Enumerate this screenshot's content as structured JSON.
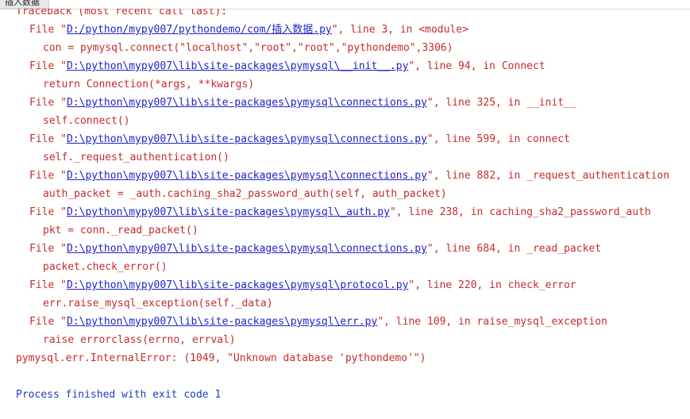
{
  "tab": {
    "title": "插入数据"
  },
  "console": {
    "header": "Traceback (most recent call last):",
    "frames": [
      {
        "prefix": "File \"",
        "path": "D:/python/mypy007/pythondemo/com/插入数据.py",
        "suffix": "\", line 3, in <module>",
        "code": "con = pymysql.connect(\"localhost\",\"root\",\"root\",\"pythondemo\",3306)"
      },
      {
        "prefix": "File \"",
        "path": "D:\\python\\mypy007\\lib\\site-packages\\pymysql\\__init__.py",
        "suffix": "\", line 94, in Connect",
        "code": "return Connection(*args, **kwargs)"
      },
      {
        "prefix": "File \"",
        "path": "D:\\python\\mypy007\\lib\\site-packages\\pymysql\\connections.py",
        "suffix": "\", line 325, in __init__",
        "code": "self.connect()"
      },
      {
        "prefix": "File \"",
        "path": "D:\\python\\mypy007\\lib\\site-packages\\pymysql\\connections.py",
        "suffix": "\", line 599, in connect",
        "code": "self._request_authentication()"
      },
      {
        "prefix": "File \"",
        "path": "D:\\python\\mypy007\\lib\\site-packages\\pymysql\\connections.py",
        "suffix": "\", line 882, in _request_authentication",
        "code": "auth_packet = _auth.caching_sha2_password_auth(self, auth_packet)"
      },
      {
        "prefix": "File \"",
        "path": "D:\\python\\mypy007\\lib\\site-packages\\pymysql\\_auth.py",
        "suffix": "\", line 238, in caching_sha2_password_auth",
        "code": "pkt = conn._read_packet()"
      },
      {
        "prefix": "File \"",
        "path": "D:\\python\\mypy007\\lib\\site-packages\\pymysql\\connections.py",
        "suffix": "\", line 684, in _read_packet",
        "code": "packet.check_error()"
      },
      {
        "prefix": "File \"",
        "path": "D:\\python\\mypy007\\lib\\site-packages\\pymysql\\protocol.py",
        "suffix": "\", line 220, in check_error",
        "code": "err.raise_mysql_exception(self._data)"
      },
      {
        "prefix": "File \"",
        "path": "D:\\python\\mypy007\\lib\\site-packages\\pymysql\\err.py",
        "suffix": "\", line 109, in raise_mysql_exception",
        "code": "raise errorclass(errno, errval)"
      }
    ],
    "error": "pymysql.err.InternalError: (1049, \"Unknown database 'pythondemo'\")",
    "exit": "Process finished with exit code 1"
  },
  "colors": {
    "error_text": "#c72b2b",
    "link": "#2222cc",
    "process_text": "#1f3fbf"
  }
}
